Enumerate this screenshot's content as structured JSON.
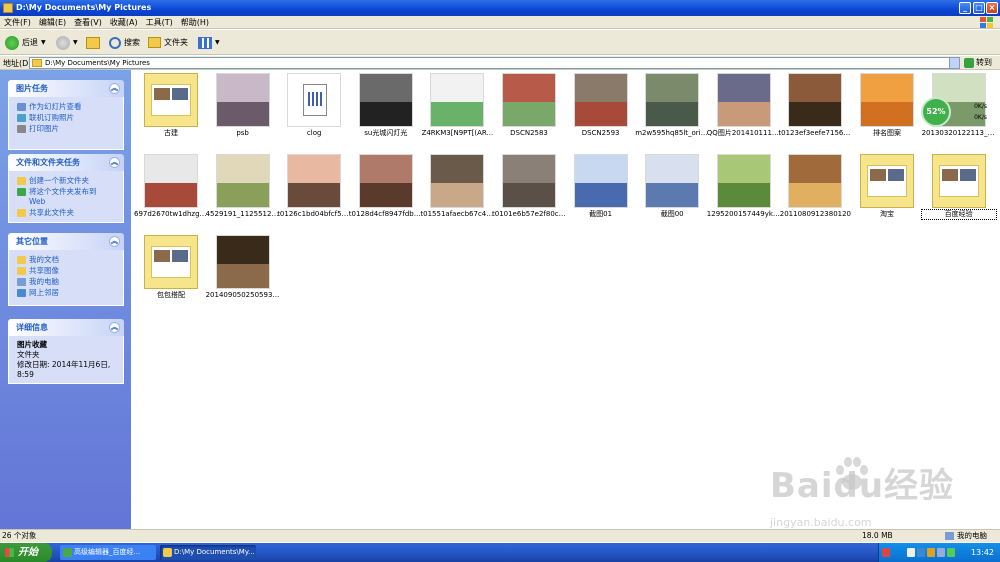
{
  "window": {
    "title": "D:\\My Documents\\My Pictures"
  },
  "menu": [
    "文件(F)",
    "编辑(E)",
    "查看(V)",
    "收藏(A)",
    "工具(T)",
    "帮助(H)"
  ],
  "toolbar": {
    "back": "后退",
    "search": "搜索",
    "folders": "文件夹"
  },
  "address": {
    "label": "地址(D)",
    "path": "D:\\My Documents\\My Pictures",
    "go": "转到"
  },
  "sidebar": {
    "picture_tasks": {
      "title": "图片任务",
      "items": [
        "作为幻灯片查看",
        "联机订购照片",
        "打印图片"
      ]
    },
    "file_tasks": {
      "title": "文件和文件夹任务",
      "items": [
        "创建一个新文件夹",
        "将这个文件夹发布到 Web",
        "共享此文件夹"
      ]
    },
    "other_places": {
      "title": "其它位置",
      "items": [
        "我的文档",
        "共享图像",
        "我的电脑",
        "网上邻居"
      ]
    },
    "details": {
      "title": "详细信息",
      "name": "图片收藏",
      "type": "文件夹",
      "modified": "修改日期: 2014年11月6日, 8:59"
    }
  },
  "files": [
    {
      "name": "古建",
      "kind": "folder"
    },
    {
      "name": "psb",
      "kind": "photo"
    },
    {
      "name": "clog",
      "kind": "doc"
    },
    {
      "name": "su光城闪灯光",
      "kind": "photo"
    },
    {
      "name": "Z4RKM3[N9PT[(AR...",
      "kind": "photo"
    },
    {
      "name": "DSCN2583",
      "kind": "photo"
    },
    {
      "name": "DSCN2593",
      "kind": "photo"
    },
    {
      "name": "m2w595hq85lt_origi...",
      "kind": "photo"
    },
    {
      "name": "QQ图片20141011154712",
      "kind": "photo"
    },
    {
      "name": "t0123ef3eefe71564fa",
      "kind": "photo"
    },
    {
      "name": "排名图案",
      "kind": "photo"
    },
    {
      "name": "20130320122113_L...",
      "kind": "photo"
    },
    {
      "name": "697d2670tw1dhzgv...",
      "kind": "photo"
    },
    {
      "name": "4529191_11255123...",
      "kind": "photo"
    },
    {
      "name": "t0126c1bd04bfcf5136",
      "kind": "photo"
    },
    {
      "name": "t0128d4cf8947fdbdf2",
      "kind": "photo"
    },
    {
      "name": "t01551afaecb67c42eb",
      "kind": "photo"
    },
    {
      "name": "t0101e6b57e2f80cf5c",
      "kind": "photo"
    },
    {
      "name": "截图01",
      "kind": "photo"
    },
    {
      "name": "截图00",
      "kind": "photo"
    },
    {
      "name": "1295200157449yk3...",
      "kind": "photo"
    },
    {
      "name": "2011080912380120",
      "kind": "photo"
    },
    {
      "name": "淘宝",
      "kind": "folder"
    },
    {
      "name": "百度经验",
      "kind": "folder"
    },
    {
      "name": "包包搭配",
      "kind": "folder"
    },
    {
      "name": "20140905025059338",
      "kind": "photo"
    }
  ],
  "net_widget": {
    "percent": "52%",
    "up": "0K/s",
    "down": "0K/s"
  },
  "status": {
    "count": "26 个对象",
    "size": "18.0 MB",
    "location": "我的电脑"
  },
  "taskbar": {
    "start": "开始",
    "tasks": [
      "高级编辑器_百度经...",
      "D:\\My Documents\\My..."
    ],
    "clock": "13:42"
  },
  "watermark": {
    "brand": "Baidu经验",
    "url": "jingyan.baidu.com"
  }
}
